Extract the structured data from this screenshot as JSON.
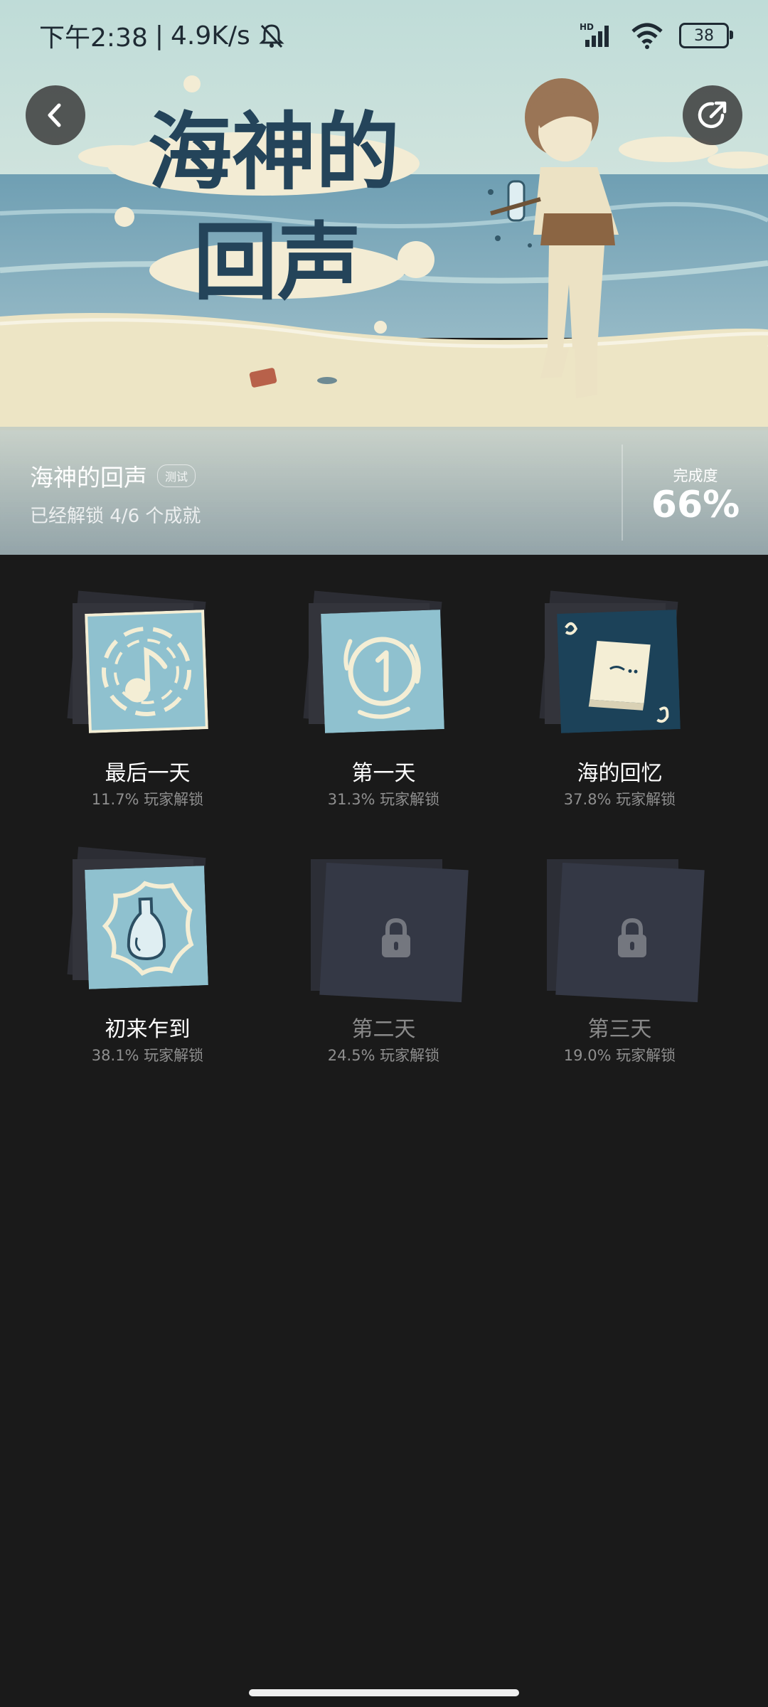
{
  "status_bar": {
    "time": "下午2:38",
    "net_speed": "4.9K/s",
    "battery": "38",
    "hd_label": "HD"
  },
  "hero": {
    "art_title_line1": "海神的",
    "art_title_line2": "回声"
  },
  "game": {
    "title": "海神的回声",
    "tag": "测试",
    "unlock_summary": "已经解锁 4/6 个成就",
    "completion_label": "完成度",
    "completion_value": "66%"
  },
  "achievements": [
    {
      "name": "最后一天",
      "rate": "11.7% 玩家解锁",
      "locked": false,
      "icon": "music-note-icon"
    },
    {
      "name": "第一天",
      "rate": "31.3% 玩家解锁",
      "locked": false,
      "icon": "number-one-icon"
    },
    {
      "name": "海的回忆",
      "rate": "37.8% 玩家解锁",
      "locked": false,
      "icon": "book-icon"
    },
    {
      "name": "初来乍到",
      "rate": "38.1% 玩家解锁",
      "locked": false,
      "icon": "bottle-icon"
    },
    {
      "name": "第二天",
      "rate": "24.5% 玩家解锁",
      "locked": true,
      "icon": "lock-icon"
    },
    {
      "name": "第三天",
      "rate": "19.0% 玩家解锁",
      "locked": true,
      "icon": "lock-icon"
    }
  ],
  "colors": {
    "background": "#1a1a1a",
    "badge_blue": "#8fc1cf",
    "badge_cream": "#f4eed5",
    "badge_dark": "#1c4259",
    "locked_card": "#343845"
  }
}
